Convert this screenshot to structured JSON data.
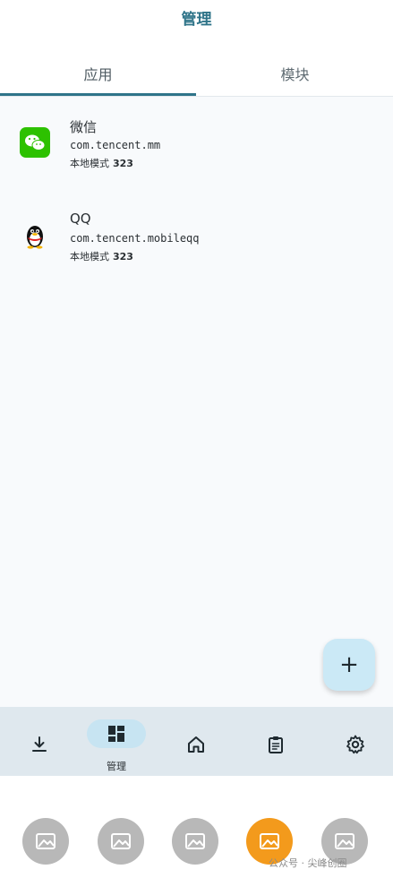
{
  "header": {
    "title": "管理"
  },
  "tabs": [
    {
      "label": "应用"
    },
    {
      "label": "模块"
    }
  ],
  "apps": [
    {
      "name": "微信",
      "package": "com.tencent.mm",
      "mode_label": "本地模式",
      "mode_value": "323",
      "icon": "wechat-icon",
      "color": "#2dc100"
    },
    {
      "name": "QQ",
      "package": "com.tencent.mobileqq",
      "mode_label": "本地模式",
      "mode_value": "323",
      "icon": "qq-penguin-icon"
    }
  ],
  "fab": {
    "label": "+"
  },
  "bottom_nav": [
    {
      "icon": "download-icon",
      "label": ""
    },
    {
      "icon": "dashboard-icon",
      "label": "管理",
      "active": true
    },
    {
      "icon": "home-icon",
      "label": ""
    },
    {
      "icon": "clipboard-icon",
      "label": ""
    },
    {
      "icon": "gear-icon",
      "label": ""
    }
  ],
  "gallery_thumbs": [
    {
      "icon": "image-icon"
    },
    {
      "icon": "image-icon"
    },
    {
      "icon": "image-icon"
    },
    {
      "icon": "image-icon",
      "active": true
    },
    {
      "icon": "image-icon"
    }
  ],
  "watermark": "公众号 · 尖峰创圈",
  "colors": {
    "accent": "#2f7489",
    "fab": "#cbe9f6",
    "nav_bg": "#dfe8ee",
    "thumb_active": "#f39a1c"
  }
}
